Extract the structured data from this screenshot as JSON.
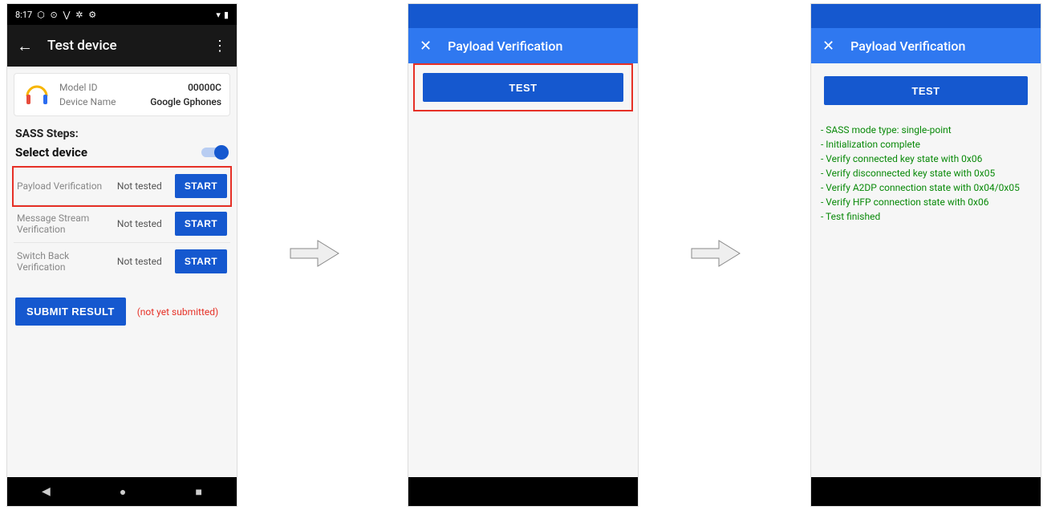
{
  "status": {
    "time": "8:17",
    "icons": "⬡ ⊙ ⋁ ✲ ⚙",
    "right": "♥ ⬛"
  },
  "appbar": {
    "title": "Test device"
  },
  "card": {
    "model_label": "Model ID",
    "model_value": "00000C",
    "name_label": "Device Name",
    "name_value": "Google Gphones"
  },
  "section_heading": "SASS Steps:",
  "select_label": "Select device",
  "tests": [
    {
      "name": "Payload Verification",
      "status": "Not tested",
      "btn": "START"
    },
    {
      "name": "Message Stream Verification",
      "status": "Not tested",
      "btn": "START"
    },
    {
      "name": "Switch Back Verification",
      "status": "Not tested",
      "btn": "START"
    }
  ],
  "submit_label": "SUBMIT RESULT",
  "pending_label": "(not yet submitted)",
  "screen2": {
    "title": "Payload Verification",
    "test_btn": "TEST"
  },
  "screen3": {
    "title": "Payload Verification",
    "test_btn": "TEST",
    "log": [
      "- SASS mode type: single-point",
      "- Initialization complete",
      "- Verify connected key state with 0x06",
      "- Verify disconnected key state with 0x05",
      "- Verify A2DP connection state with 0x04/0x05",
      "- Verify HFP connection state with 0x06",
      "- Test finished"
    ]
  }
}
